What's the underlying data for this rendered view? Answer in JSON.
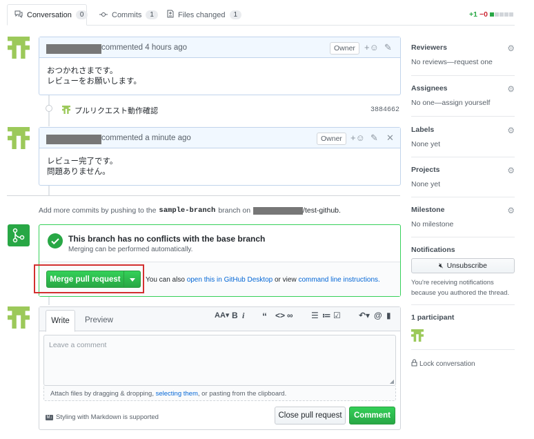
{
  "tabs": [
    {
      "label": "Conversation",
      "count": "0"
    },
    {
      "label": "Commits",
      "count": "1"
    },
    {
      "label": "Files changed",
      "count": "1"
    }
  ],
  "diffstat": {
    "additions": "+1",
    "deletions": "−0"
  },
  "comments": [
    {
      "meta": "commented 4 hours ago",
      "badge": "Owner",
      "lines": [
        "おつかれさまです。",
        "レビューをお願いします。"
      ]
    },
    {
      "meta": "commented a minute ago",
      "badge": "Owner",
      "lines": [
        "レビュー完了です。",
        "問題ありません。"
      ]
    }
  ],
  "commit": {
    "message": "プルリクエスト動作確認",
    "sha": "3884662"
  },
  "push_note": {
    "prefix": "Add more commits by pushing to the",
    "branch": "sample-branch",
    "middle": "branch on",
    "repo": "/test-github."
  },
  "merge": {
    "title": "This branch has no conflicts with the base branch",
    "subtitle": "Merging can be performed automatically.",
    "button": "Merge pull request",
    "hint_prefix": "You can also",
    "hint_link1": "open this in GitHub Desktop",
    "hint_middle": "or view",
    "hint_link2": "command line instructions."
  },
  "editor": {
    "tab_write": "Write",
    "tab_preview": "Preview",
    "placeholder": "Leave a comment",
    "attach_prefix": "Attach files by dragging & dropping,",
    "attach_link": "selecting them",
    "attach_suffix": ", or pasting from the clipboard.",
    "markdown_note": "Styling with Markdown is supported",
    "close_button": "Close pull request",
    "comment_button": "Comment"
  },
  "sidebar": {
    "reviewers": {
      "title": "Reviewers",
      "value": "No reviews—request one"
    },
    "assignees": {
      "title": "Assignees",
      "value": "No one—assign yourself"
    },
    "labels": {
      "title": "Labels",
      "value": "None yet"
    },
    "projects": {
      "title": "Projects",
      "value": "None yet"
    },
    "milestone": {
      "title": "Milestone",
      "value": "No milestone"
    },
    "notifications": {
      "title": "Notifications",
      "button": "Unsubscribe",
      "note1": "You're receiving notifications",
      "note2": "because you authored the thread."
    },
    "participants": {
      "title": "1 participant"
    },
    "lock": "Lock conversation"
  },
  "colors": {
    "green": "#28a745",
    "highlight_red": "#d32f2f",
    "avatar_green": "#9cc95a"
  }
}
